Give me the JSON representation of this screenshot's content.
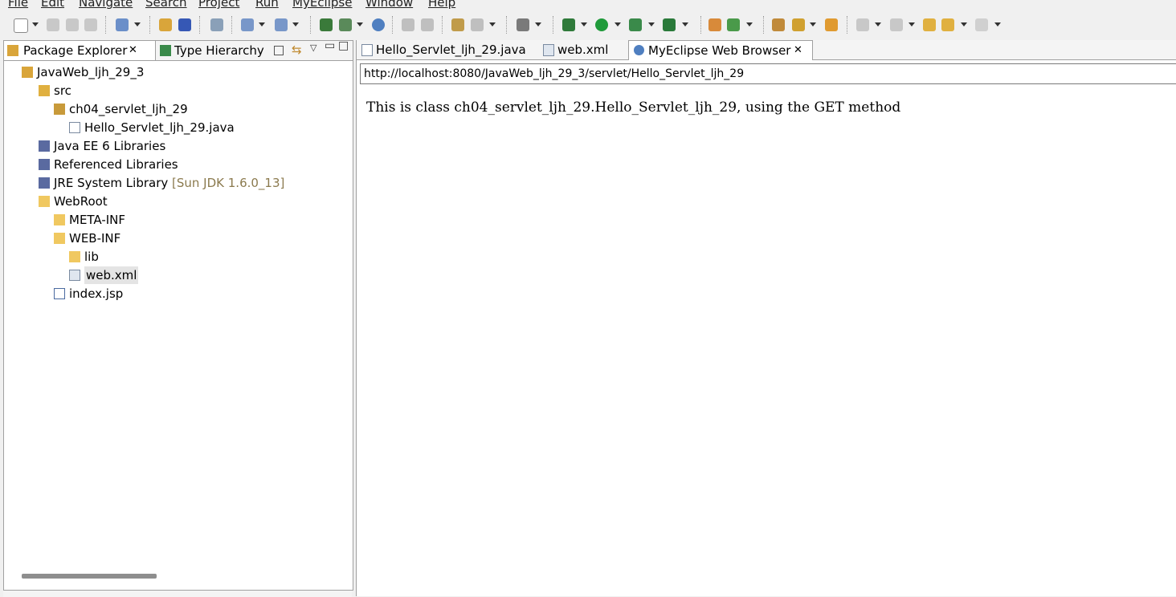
{
  "menu": [
    "File",
    "Edit",
    "Navigate",
    "Search",
    "Project",
    "Run",
    "MyEclipse",
    "Window",
    "Help"
  ],
  "left_panel": {
    "tabs": [
      {
        "label": "Package Explorer",
        "closable": true
      },
      {
        "label": "Type Hierarchy",
        "closable": false
      }
    ],
    "tree": [
      {
        "label": "JavaWeb_ljh_29_3",
        "icon": "project-icon",
        "depth": 0
      },
      {
        "label": "src",
        "icon": "source-folder-icon",
        "depth": 1
      },
      {
        "label": "ch04_servlet_ljh_29",
        "icon": "package-icon",
        "depth": 2
      },
      {
        "label": "Hello_Servlet_ljh_29.java",
        "icon": "java-file-icon",
        "depth": 3
      },
      {
        "label": "Java EE 6 Libraries",
        "icon": "library-icon",
        "depth": 1
      },
      {
        "label": "Referenced Libraries",
        "icon": "library-icon",
        "depth": 1
      },
      {
        "label": "JRE System Library",
        "decoration": "[Sun JDK 1.6.0_13]",
        "icon": "library-icon",
        "depth": 1
      },
      {
        "label": "WebRoot",
        "icon": "folder-icon",
        "depth": 1
      },
      {
        "label": "META-INF",
        "icon": "folder-icon",
        "depth": 2
      },
      {
        "label": "WEB-INF",
        "icon": "folder-icon",
        "depth": 2
      },
      {
        "label": "lib",
        "icon": "folder-icon",
        "depth": 3
      },
      {
        "label": "web.xml",
        "icon": "xml-file-icon",
        "depth": 3,
        "selected": true
      },
      {
        "label": "index.jsp",
        "icon": "jsp-file-icon",
        "depth": 2
      }
    ]
  },
  "editor": {
    "tabs": [
      {
        "label": "Hello_Servlet_ljh_29.java",
        "active": false
      },
      {
        "label": "web.xml",
        "active": false
      },
      {
        "label": "MyEclipse Web Browser",
        "active": true,
        "closable": true
      }
    ],
    "url": "http://localhost:8080/JavaWeb_ljh_29_3/servlet/Hello_Servlet_ljh_29",
    "page_text": "This is class ch04_servlet_ljh_29.Hello_Servlet_ljh_29, using the GET method"
  },
  "colors": {
    "selection": "#e4e4e4",
    "decoration": "#8b7a4e"
  }
}
